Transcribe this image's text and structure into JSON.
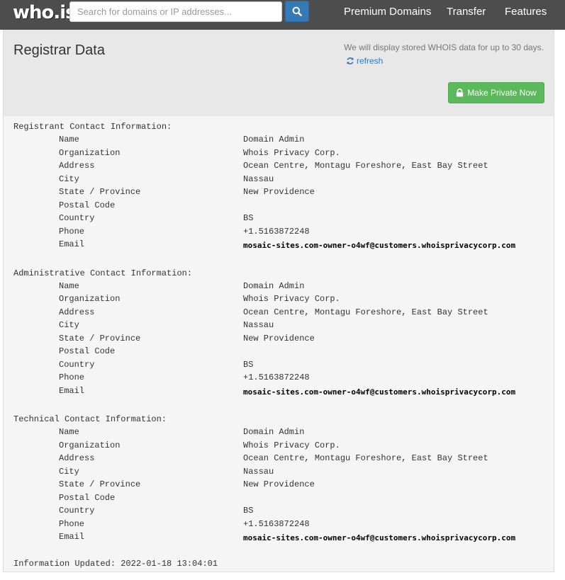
{
  "header": {
    "logo": "who.is",
    "search_placeholder": "Search for domains or IP addresses...",
    "nav": [
      "Premium Domains",
      "Transfer",
      "Features"
    ]
  },
  "panel": {
    "title": "Registrar Data",
    "note": "We will display stored WHOIS data for up to 30 days.",
    "refresh_label": "refresh",
    "private_button": "Make Private Now"
  },
  "labels": [
    "Name",
    "Organization",
    "Address",
    "City",
    "State / Province",
    "Postal Code",
    "Country",
    "Phone",
    "Email"
  ],
  "contacts": [
    {
      "title": "Registrant Contact Information:",
      "values": [
        "Domain Admin",
        "Whois Privacy Corp.",
        "Ocean Centre, Montagu Foreshore, East Bay Street",
        "Nassau",
        "New Providence",
        "",
        "BS",
        "+1.5163872248",
        "mosaic-sites.com-owner-o4wf@customers.whoisprivacycorp.com"
      ]
    },
    {
      "title": "Administrative Contact Information:",
      "values": [
        "Domain Admin",
        "Whois Privacy Corp.",
        "Ocean Centre, Montagu Foreshore, East Bay Street",
        "Nassau",
        "New Providence",
        "",
        "BS",
        "+1.5163872248",
        "mosaic-sites.com-owner-o4wf@customers.whoisprivacycorp.com"
      ]
    },
    {
      "title": "Technical Contact Information:",
      "values": [
        "Domain Admin",
        "Whois Privacy Corp.",
        "Ocean Centre, Montagu Foreshore, East Bay Street",
        "Nassau",
        "New Providence",
        "",
        "BS",
        "+1.5163872248",
        "mosaic-sites.com-owner-o4wf@customers.whoisprivacycorp.com"
      ]
    }
  ],
  "updated": "Information Updated: 2022-01-18 13:04:01",
  "colors": {
    "nav_bg": "#4d4d4d",
    "search_btn": "#337ab7",
    "private_btn": "#5cb85c",
    "link": "#337ab7"
  }
}
